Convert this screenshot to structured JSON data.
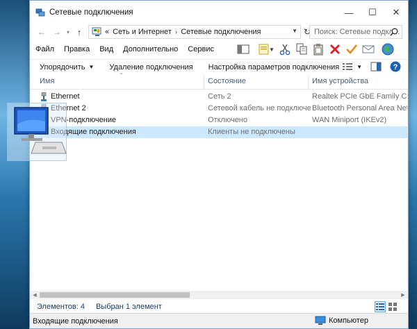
{
  "window": {
    "title": "Сетевые подключения",
    "controls": {
      "minimize": "—",
      "maximize": "☐",
      "close": "✕"
    }
  },
  "address": {
    "back": "←",
    "forward": "→",
    "up": "↑",
    "crumb_prefix": "«",
    "crumbs": [
      "Сеть и Интернет",
      "Сетевые подключения"
    ],
    "separator": "›",
    "refresh": "↻",
    "search_placeholder": "Поиск: Сетевые подкл..."
  },
  "menu": [
    "Файл",
    "Правка",
    "Вид",
    "Дополнительно",
    "Сервис"
  ],
  "commands": {
    "organize": "Упорядочить",
    "delete_connection": "Удаление подключения",
    "configure": "Настройка параметров подключения"
  },
  "columns": {
    "name": "Имя",
    "state": "Состояние",
    "device": "Имя устройства"
  },
  "rows": [
    {
      "name": "Ethernet",
      "state": "Сеть  2",
      "device": "Realtek PCIe GbE Family Contro...",
      "selected": false
    },
    {
      "name": "Ethernet 2",
      "state": "Сетевой кабель не подключен",
      "device": "Bluetooth Personal Area Network",
      "selected": false
    },
    {
      "name": "VPN-подключение",
      "state": "Отключено",
      "device": "WAN Miniport (IKEv2)",
      "selected": false
    },
    {
      "name": "Входящие подключения",
      "state": "Клиенты не подключены",
      "device": "",
      "selected": true
    }
  ],
  "status": {
    "items_count": "Элементов: 4",
    "selected": "Выбран 1 элемент"
  },
  "details": {
    "selected_name": "Входящие подключения",
    "location": "Компьютер"
  },
  "colors": {
    "selection": "#cce8ff",
    "header_text": "#4c607a",
    "status_text": "#1e395b",
    "close_red": "#d9232e",
    "check_orange": "#e08a1e"
  }
}
